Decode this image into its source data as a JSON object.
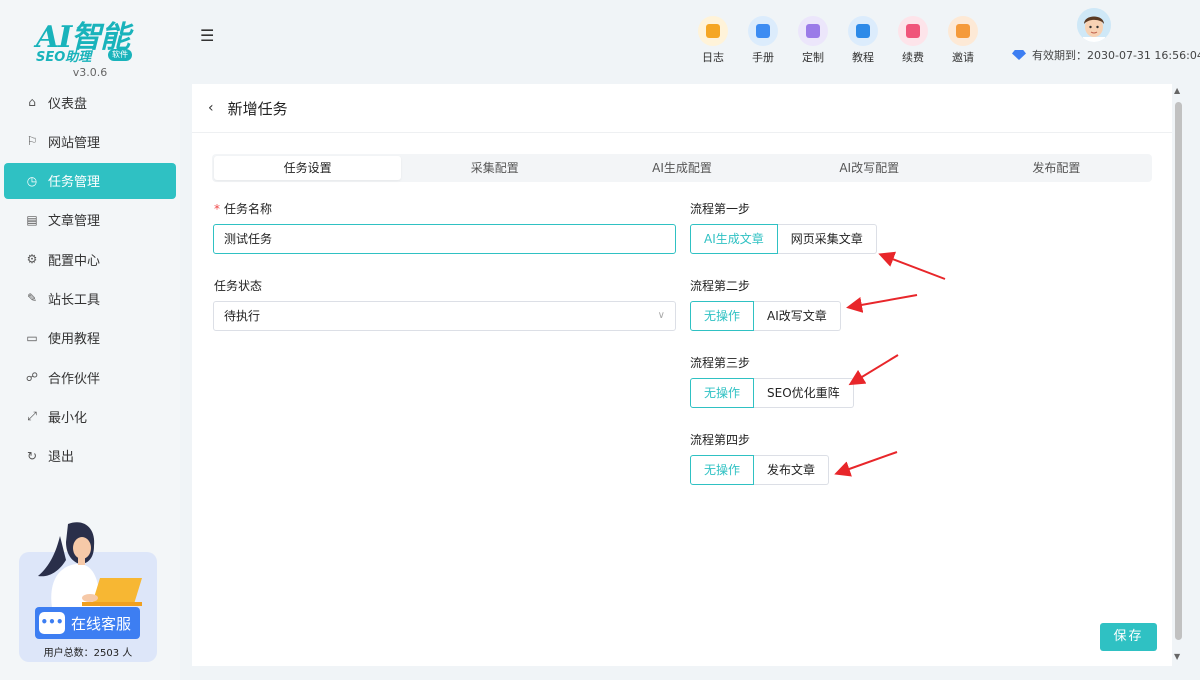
{
  "app": {
    "logo_text": "AI智能",
    "logo_sub": "SEO助理",
    "logo_badge": "软件",
    "version": "v3.0.6"
  },
  "sidebar": {
    "items": [
      {
        "label": "仪表盘",
        "icon": "home-icon"
      },
      {
        "label": "网站管理",
        "icon": "flag-icon"
      },
      {
        "label": "任务管理",
        "icon": "clock-icon",
        "active": true
      },
      {
        "label": "文章管理",
        "icon": "document-icon"
      },
      {
        "label": "配置中心",
        "icon": "gear-icon"
      },
      {
        "label": "站长工具",
        "icon": "wrench-icon"
      },
      {
        "label": "使用教程",
        "icon": "monitor-icon"
      },
      {
        "label": "合作伙伴",
        "icon": "partner-icon"
      },
      {
        "label": "最小化",
        "icon": "minimize-icon"
      },
      {
        "label": "退出",
        "icon": "logout-icon"
      }
    ],
    "service_label": "在线客服",
    "user_count": "用户总数：2503 人"
  },
  "header": {
    "tools": [
      {
        "label": "日志",
        "icon": "log-icon",
        "bg": "#fff3d9",
        "color": "#f5a623"
      },
      {
        "label": "手册",
        "icon": "manual-icon",
        "bg": "#dcecfc",
        "color": "#3d8cf2"
      },
      {
        "label": "定制",
        "icon": "customize-icon",
        "bg": "#ece6fb",
        "color": "#9b7be8"
      },
      {
        "label": "教程",
        "icon": "tutorial-icon",
        "bg": "#dcecfc",
        "color": "#2d8ae8"
      },
      {
        "label": "续费",
        "icon": "renew-icon",
        "bg": "#fde4ea",
        "color": "#f0557a"
      },
      {
        "label": "邀请",
        "icon": "invite-icon",
        "bg": "#fde9d6",
        "color": "#f59a3a"
      }
    ],
    "expiry": "有效期到：2030-07-31 16:56:04"
  },
  "page": {
    "title": "新增任务",
    "tabs": [
      "任务设置",
      "采集配置",
      "AI生成配置",
      "AI改写配置",
      "发布配置"
    ],
    "active_tab": 0,
    "task_name_label": "任务名称",
    "task_name_value": "测试任务",
    "task_status_label": "任务状态",
    "task_status_value": "待执行",
    "steps": [
      {
        "label": "流程第一步",
        "options": [
          "AI生成文章",
          "网页采集文章"
        ],
        "selected": 0
      },
      {
        "label": "流程第二步",
        "options": [
          "无操作",
          "AI改写文章"
        ],
        "selected": 0
      },
      {
        "label": "流程第三步",
        "options": [
          "无操作",
          "SEO优化重阵"
        ],
        "selected": 0
      },
      {
        "label": "流程第四步",
        "options": [
          "无操作",
          "发布文章"
        ],
        "selected": 0
      }
    ],
    "save_label": "保存"
  },
  "colors": {
    "accent": "#2fc1c3",
    "arrow": "#e8262a"
  }
}
